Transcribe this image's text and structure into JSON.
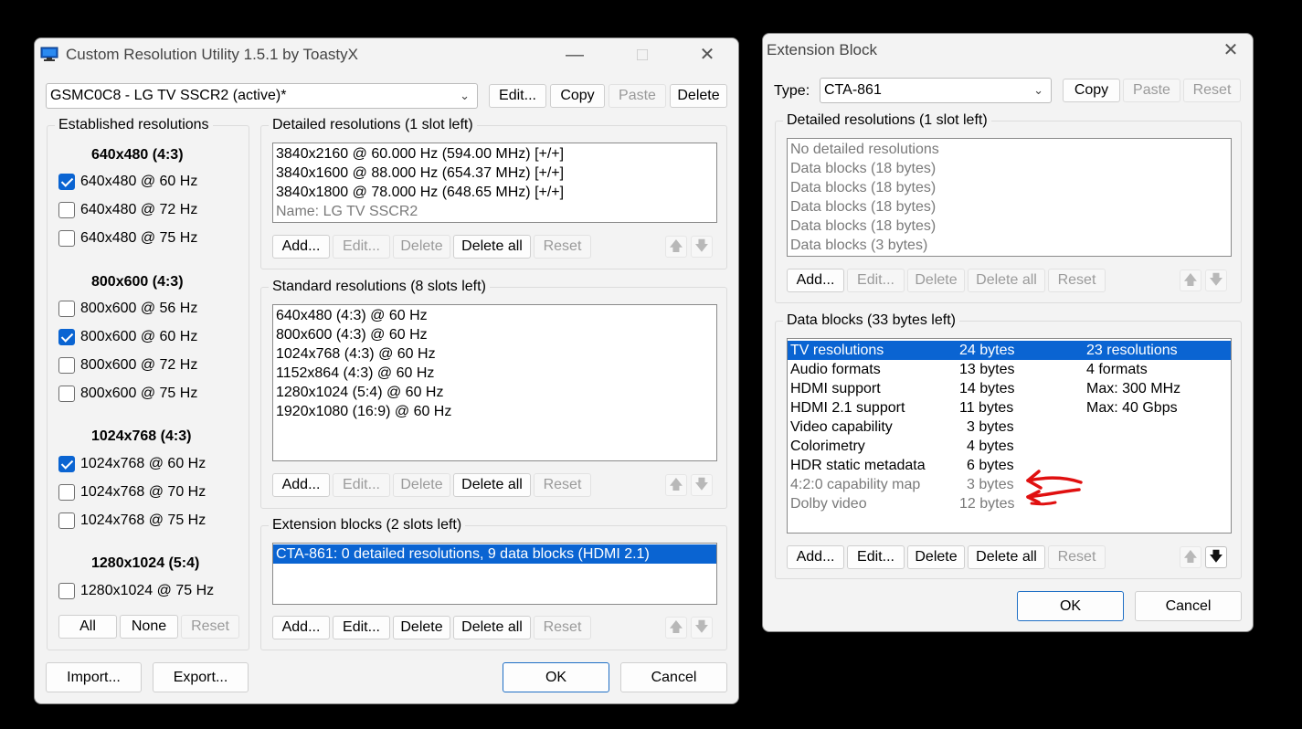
{
  "cru": {
    "title": "Custom Resolution Utility 1.5.1 by ToastyX",
    "monitor": "GSMC0C8 - LG TV SSCR2 (active)*",
    "top_buttons": [
      "Edit...",
      "Copy",
      "Paste",
      "Delete"
    ],
    "established": {
      "label": "Established resolutions",
      "groups": [
        {
          "heading": "640x480 (4:3)",
          "items": [
            {
              "label": "640x480 @ 60 Hz",
              "checked": true
            },
            {
              "label": "640x480 @ 72 Hz",
              "checked": false
            },
            {
              "label": "640x480 @ 75 Hz",
              "checked": false
            }
          ]
        },
        {
          "heading": "800x600 (4:3)",
          "items": [
            {
              "label": "800x600 @ 56 Hz",
              "checked": false
            },
            {
              "label": "800x600 @ 60 Hz",
              "checked": true
            },
            {
              "label": "800x600 @ 72 Hz",
              "checked": false
            },
            {
              "label": "800x600 @ 75 Hz",
              "checked": false
            }
          ]
        },
        {
          "heading": "1024x768 (4:3)",
          "items": [
            {
              "label": "1024x768 @ 60 Hz",
              "checked": true
            },
            {
              "label": "1024x768 @ 70 Hz",
              "checked": false
            },
            {
              "label": "1024x768 @ 75 Hz",
              "checked": false
            }
          ]
        },
        {
          "heading": "1280x1024 (5:4)",
          "items": [
            {
              "label": "1280x1024 @ 75 Hz",
              "checked": false
            }
          ]
        }
      ],
      "buttons": [
        "All",
        "None",
        "Reset"
      ]
    },
    "detailed": {
      "label": "Detailed resolutions (1 slot left)",
      "items": [
        {
          "text": "3840x2160 @ 60.000 Hz (594.00 MHz) [+/+]",
          "gray": false
        },
        {
          "text": "3840x1600 @ 88.000 Hz (654.37 MHz) [+/+]",
          "gray": false
        },
        {
          "text": "3840x1800 @ 78.000 Hz (648.65 MHz) [+/+]",
          "gray": false
        },
        {
          "text": "Name: LG TV SSCR2",
          "gray": true
        }
      ]
    },
    "standard": {
      "label": "Standard resolutions (8 slots left)",
      "items": [
        "640x480 (4:3) @ 60 Hz",
        "800x600 (4:3) @ 60 Hz",
        "1024x768 (4:3) @ 60 Hz",
        "1152x864 (4:3) @ 60 Hz",
        "1280x1024 (5:4) @ 60 Hz",
        "1920x1080 (16:9) @ 60 Hz"
      ]
    },
    "extension": {
      "label": "Extension blocks (2 slots left)",
      "items": [
        "CTA-861: 0 detailed resolutions, 9 data blocks (HDMI 2.1)"
      ]
    },
    "list_buttons": [
      "Add...",
      "Edit...",
      "Delete",
      "Delete all",
      "Reset"
    ],
    "bottom_buttons": {
      "import": "Import...",
      "export": "Export...",
      "ok": "OK",
      "cancel": "Cancel"
    }
  },
  "ext": {
    "title": "Extension Block",
    "type_label": "Type:",
    "type_value": "CTA-861",
    "top_buttons": [
      "Copy",
      "Paste",
      "Reset"
    ],
    "detailed": {
      "label": "Detailed resolutions (1 slot left)",
      "items": [
        "No detailed resolutions",
        "Data blocks (18 bytes)",
        "Data blocks (18 bytes)",
        "Data blocks (18 bytes)",
        "Data blocks (18 bytes)",
        "Data blocks (3 bytes)"
      ]
    },
    "data_blocks": {
      "label": "Data blocks (33 bytes left)",
      "rows": [
        {
          "name": "TV resolutions",
          "size": "24 bytes",
          "info": "23 resolutions",
          "selected": true,
          "gray": false
        },
        {
          "name": "Audio formats",
          "size": "13 bytes",
          "info": "4 formats",
          "selected": false,
          "gray": false
        },
        {
          "name": "HDMI support",
          "size": "14 bytes",
          "info": "Max: 300 MHz",
          "selected": false,
          "gray": false
        },
        {
          "name": "HDMI 2.1 support",
          "size": "11 bytes",
          "info": "Max: 40 Gbps",
          "selected": false,
          "gray": false
        },
        {
          "name": "Video capability",
          "size": "3 bytes",
          "info": "",
          "selected": false,
          "gray": false
        },
        {
          "name": "Colorimetry",
          "size": "4 bytes",
          "info": "",
          "selected": false,
          "gray": false
        },
        {
          "name": "HDR static metadata",
          "size": "6 bytes",
          "info": "",
          "selected": false,
          "gray": false
        },
        {
          "name": "4:2:0 capability map",
          "size": "3 bytes",
          "info": "",
          "selected": false,
          "gray": true
        },
        {
          "name": "Dolby video",
          "size": "12 bytes",
          "info": "",
          "selected": false,
          "gray": true
        }
      ]
    },
    "list_buttons": [
      "Add...",
      "Edit...",
      "Delete",
      "Delete all",
      "Reset"
    ],
    "ok": "OK",
    "cancel": "Cancel"
  },
  "colors": {
    "selection": "#0a64d2",
    "annotation": "#e01010",
    "window_bg": "#f3f3f3"
  },
  "icons": {
    "close": "close-icon",
    "maximize": "maximize-icon",
    "minimize": "minimize-icon",
    "app": "monitor-icon"
  }
}
